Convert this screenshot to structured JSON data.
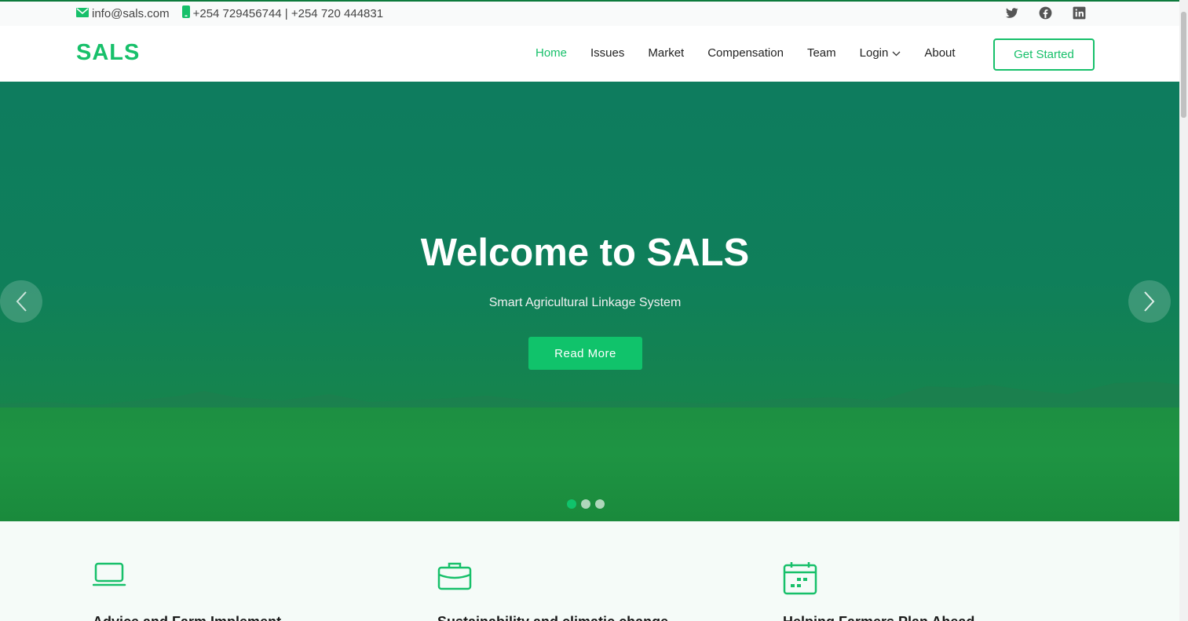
{
  "topbar": {
    "email": "info@sals.com",
    "phone": "+254 729456744 | +254 720 444831",
    "icons": {
      "email": "envelope-icon",
      "phone": "phone-icon"
    },
    "social": [
      "twitter-icon",
      "facebook-icon",
      "linkedin-icon"
    ]
  },
  "navbar": {
    "logo": "SALS",
    "items": [
      {
        "label": "Home",
        "active": true
      },
      {
        "label": "Issues"
      },
      {
        "label": "Market"
      },
      {
        "label": "Compensation"
      },
      {
        "label": "Team"
      },
      {
        "label": "Login",
        "dropdown": true
      },
      {
        "label": "About"
      }
    ],
    "cta": "Get Started"
  },
  "hero": {
    "title": "Welcome to SALS",
    "subtitle": "Smart Agricultural Linkage System",
    "button": "Read More",
    "slides": 3,
    "active_slide": 1
  },
  "features": [
    {
      "icon": "laptop-icon",
      "title": "Advice and Farm Implement"
    },
    {
      "icon": "briefcase-icon",
      "title": "Sustainability and climatic change"
    },
    {
      "icon": "calendar-icon",
      "title": "Helping Farmers Plan Ahead"
    }
  ],
  "colors": {
    "accent": "#17c06a",
    "hero_overlay": "#0e7c5e"
  }
}
